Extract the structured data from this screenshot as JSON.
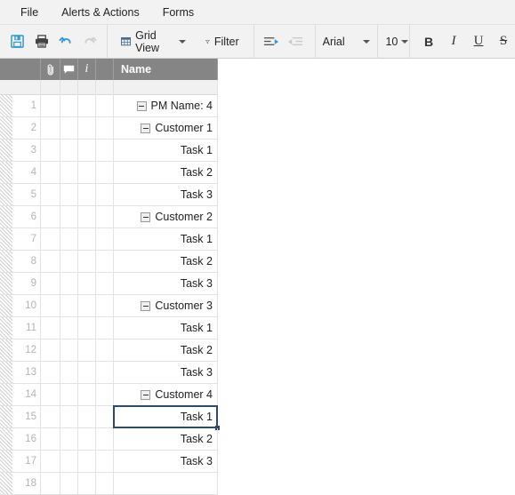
{
  "menubar": {
    "items": [
      {
        "label": "File",
        "name": "menu-file"
      },
      {
        "label": "Alerts & Actions",
        "name": "menu-alerts-actions"
      },
      {
        "label": "Forms",
        "name": "menu-forms"
      }
    ]
  },
  "toolbar": {
    "save_icon": "save-icon",
    "print_icon": "print-icon",
    "undo_icon": "undo-icon",
    "redo_icon": "redo-icon",
    "grid_view_label": "Grid View",
    "filter_label": "Filter",
    "indent_icon": "indent-increase-icon",
    "outdent_icon": "indent-decrease-icon",
    "font_family": "Arial",
    "font_size": "10",
    "bold_label": "B",
    "italic_label": "I",
    "underline_label": "U",
    "strikethrough_label": "S"
  },
  "grid": {
    "headers": {
      "gutter": "",
      "attachment": "paperclip-icon",
      "comment": "comment-icon",
      "info": "i",
      "name": "Name"
    },
    "rows": [
      {
        "num": "1",
        "label": "PM Name: 4",
        "indent": 0,
        "toggle": true,
        "selected": false
      },
      {
        "num": "2",
        "label": "Customer 1",
        "indent": 1,
        "toggle": true,
        "selected": false
      },
      {
        "num": "3",
        "label": "Task 1",
        "indent": 2,
        "toggle": false,
        "selected": false
      },
      {
        "num": "4",
        "label": "Task 2",
        "indent": 2,
        "toggle": false,
        "selected": false
      },
      {
        "num": "5",
        "label": "Task 3",
        "indent": 2,
        "toggle": false,
        "selected": false
      },
      {
        "num": "6",
        "label": "Customer 2",
        "indent": 1,
        "toggle": true,
        "selected": false
      },
      {
        "num": "7",
        "label": "Task 1",
        "indent": 2,
        "toggle": false,
        "selected": false
      },
      {
        "num": "8",
        "label": "Task 2",
        "indent": 2,
        "toggle": false,
        "selected": false
      },
      {
        "num": "9",
        "label": "Task 3",
        "indent": 2,
        "toggle": false,
        "selected": false
      },
      {
        "num": "10",
        "label": "Customer 3",
        "indent": 1,
        "toggle": true,
        "selected": false
      },
      {
        "num": "11",
        "label": "Task 1",
        "indent": 2,
        "toggle": false,
        "selected": false
      },
      {
        "num": "12",
        "label": "Task 2",
        "indent": 2,
        "toggle": false,
        "selected": false
      },
      {
        "num": "13",
        "label": "Task 3",
        "indent": 2,
        "toggle": false,
        "selected": false
      },
      {
        "num": "14",
        "label": "Customer 4",
        "indent": 1,
        "toggle": true,
        "selected": false
      },
      {
        "num": "15",
        "label": "Task 1",
        "indent": 2,
        "toggle": false,
        "selected": true
      },
      {
        "num": "16",
        "label": "Task 2",
        "indent": 2,
        "toggle": false,
        "selected": false
      },
      {
        "num": "17",
        "label": "Task 3",
        "indent": 2,
        "toggle": false,
        "selected": false
      },
      {
        "num": "18",
        "label": "",
        "indent": 0,
        "toggle": false,
        "selected": false
      }
    ]
  },
  "colors": {
    "accent": "#3498d6",
    "header_bg": "#858585",
    "selection_border": "#2d4a66",
    "toolbar_bg": "#f2f2f2"
  }
}
